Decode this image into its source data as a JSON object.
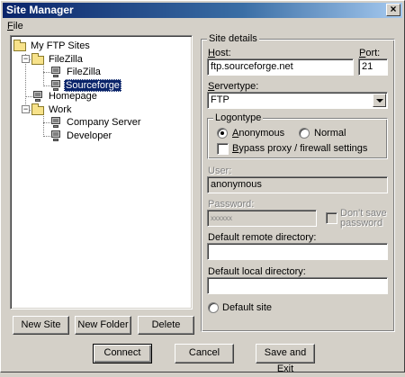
{
  "window": {
    "title": "Site Manager",
    "close_glyph": "×"
  },
  "menu": {
    "file": "File"
  },
  "tree": {
    "root": "My FTP Sites",
    "items": [
      {
        "label": "FileZilla",
        "type": "folder"
      },
      {
        "label": "FileZilla",
        "type": "site"
      },
      {
        "label": "Sourceforge",
        "type": "site",
        "selected": true
      },
      {
        "label": "Homepage",
        "type": "site"
      },
      {
        "label": "Work",
        "type": "folder"
      },
      {
        "label": "Company Server",
        "type": "site"
      },
      {
        "label": "Developer",
        "type": "site"
      }
    ]
  },
  "tree_buttons": {
    "new_site": "New Site",
    "new_folder": "New Folder",
    "delete": "Delete"
  },
  "details": {
    "group_title": "Site details",
    "host_label": "Host:",
    "host_value": "ftp.sourceforge.net",
    "port_label": "Port:",
    "port_value": "21",
    "servertype_label": "Servertype:",
    "servertype_value": "FTP",
    "logontype_title": "Logontype",
    "anonymous_label": "Anonymous",
    "normal_label": "Normal",
    "logontype_selected": "Anonymous",
    "bypass_label": "Bypass proxy / firewall settings",
    "user_label": "User:",
    "user_value": "anonymous",
    "password_label": "Password:",
    "password_value": "xxxxxx",
    "dont_save_label_line1": "Don't save",
    "dont_save_label_line2": "password",
    "remote_dir_label": "Default remote directory:",
    "remote_dir_value": "",
    "local_dir_label": "Default local directory:",
    "local_dir_value": "",
    "default_site_label": "Default site"
  },
  "bottom_buttons": {
    "connect": "Connect",
    "cancel": "Cancel",
    "save_exit": "Save and Exit"
  },
  "colors": {
    "titlebar": "#0a246a",
    "face": "#d4d0c8",
    "selection": "#0a246a"
  }
}
